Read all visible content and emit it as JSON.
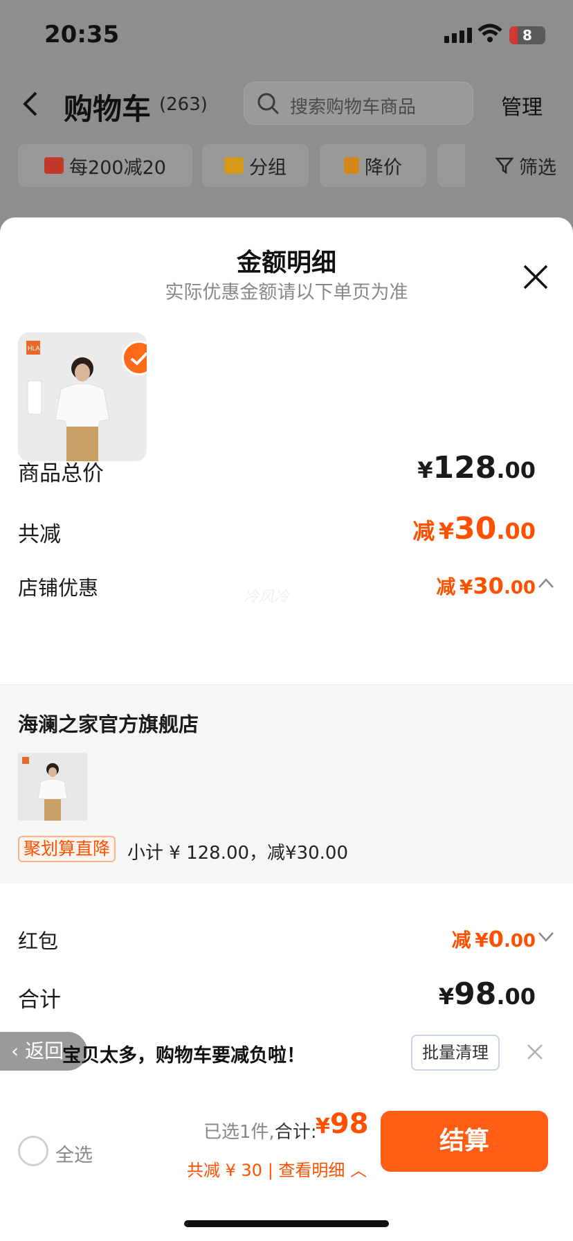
{
  "status_bar": {
    "time": "20:35",
    "battery": "8"
  },
  "cart_header": {
    "title": "购物车",
    "count": "(263)",
    "search_placeholder": "搜索购物车商品",
    "manage": "管理"
  },
  "chips": [
    {
      "label": "每200减20",
      "icon": "store-icon"
    },
    {
      "label": "分组",
      "icon": "folder-icon"
    },
    {
      "label": "降价",
      "icon": "price-drop-icon"
    },
    {
      "label": "筛选",
      "icon": "filter-icon"
    }
  ],
  "sheet": {
    "title": "金额明细",
    "subtitle": "实际优惠金额请以下单页为准",
    "product_thumb_brand": "HLA",
    "rows": {
      "total": {
        "label": "商品总价",
        "yen": "¥",
        "int": "128",
        "dec": ".00"
      },
      "reduce": {
        "label": "共减",
        "prefix": "减",
        "yen": "¥",
        "int": "30",
        "dec": ".00"
      },
      "shop_discount": {
        "label": "店铺优惠",
        "prefix": "减",
        "yen": "¥",
        "int": "30",
        "dec": ".00"
      },
      "red_packet": {
        "label": "红包",
        "prefix": "减",
        "yen": "¥",
        "int": "0",
        "dec": ".00"
      },
      "sum": {
        "label": "合计",
        "yen": "¥",
        "int": "98",
        "dec": ".00"
      }
    },
    "watermark": "冷风冷",
    "shop": {
      "name": "海澜之家官方旗舰店",
      "promo_tag": "聚划算直降",
      "subtotal_text": "小计 ¥ 128.00，减¥30.00"
    }
  },
  "notice": {
    "back": "返回",
    "text": "宝贝太多，购物车要减负啦！",
    "batch_clean": "批量清理"
  },
  "bottom_bar": {
    "select_all": "全选",
    "selected": "已选1件,",
    "total_label": "合计:",
    "total_yen": "¥",
    "total_value": "98",
    "reduce_detail": "共减 ¥ 30 | 查看明细"
  },
  "checkout": "结算",
  "colors": {
    "accent": "#ff5000",
    "checkout": "#ff5e14",
    "promo_border": "#ffb28a"
  }
}
